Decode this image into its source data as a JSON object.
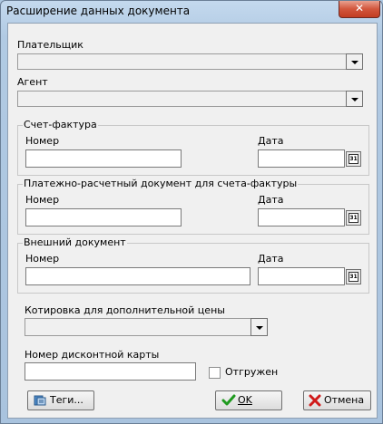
{
  "window": {
    "title": "Расширение данных документа",
    "close_glyph": "✕"
  },
  "payer": {
    "label": "Плательщик",
    "value": ""
  },
  "agent": {
    "label": "Агент",
    "value": ""
  },
  "invoice": {
    "group_label": "Счет-фактура",
    "number_label": "Номер",
    "number_value": "",
    "date_label": "Дата",
    "date_value": ""
  },
  "payment_doc": {
    "group_label": "Платежно-расчетный документ для счета-фактуры",
    "number_label": "Номер",
    "number_value": "",
    "date_label": "Дата",
    "date_value": ""
  },
  "external_doc": {
    "group_label": "Внешний документ",
    "number_label": "Номер",
    "number_value": "",
    "date_label": "Дата",
    "date_value": ""
  },
  "quote": {
    "label": "Котировка для дополнительной цены",
    "value": ""
  },
  "discount_card": {
    "label": "Номер дисконтной карты",
    "value": ""
  },
  "shipped": {
    "label": "Отгружен",
    "checked": false
  },
  "calendar_icon_text": "31",
  "buttons": {
    "tags": "Теги...",
    "ok": "OK",
    "cancel": "Отмена"
  }
}
